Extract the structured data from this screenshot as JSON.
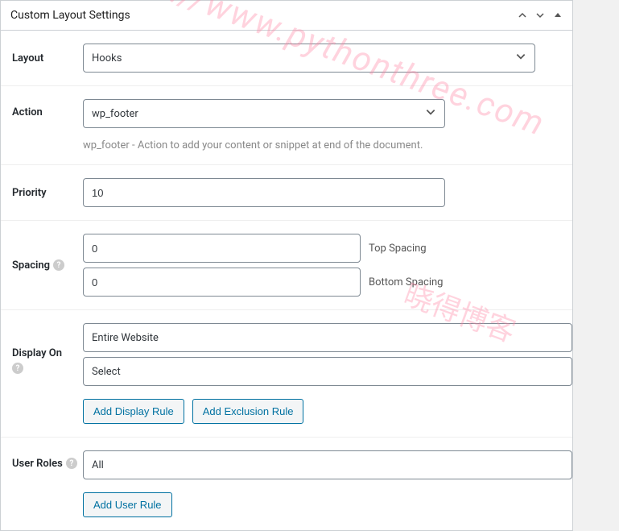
{
  "panel": {
    "title": "Custom Layout Settings"
  },
  "layout": {
    "label": "Layout",
    "value": "Hooks"
  },
  "action": {
    "label": "Action",
    "value": "wp_footer",
    "hint": "wp_footer - Action to add your content or snippet at end of the document."
  },
  "priority": {
    "label": "Priority",
    "value": "10"
  },
  "spacing": {
    "label": "Spacing",
    "top_value": "0",
    "top_label": "Top Spacing",
    "bottom_value": "0",
    "bottom_label": "Bottom Spacing"
  },
  "display_on": {
    "label": "Display On",
    "include_value": "Entire Website",
    "exclude_value": "Select",
    "add_display_btn": "Add Display Rule",
    "add_exclusion_btn": "Add Exclusion Rule"
  },
  "user_roles": {
    "label": "User Roles",
    "value": "All",
    "add_btn": "Add User Rule"
  },
  "watermark": {
    "url": "https://www.pythonthree.com",
    "text": "晓得博客"
  }
}
